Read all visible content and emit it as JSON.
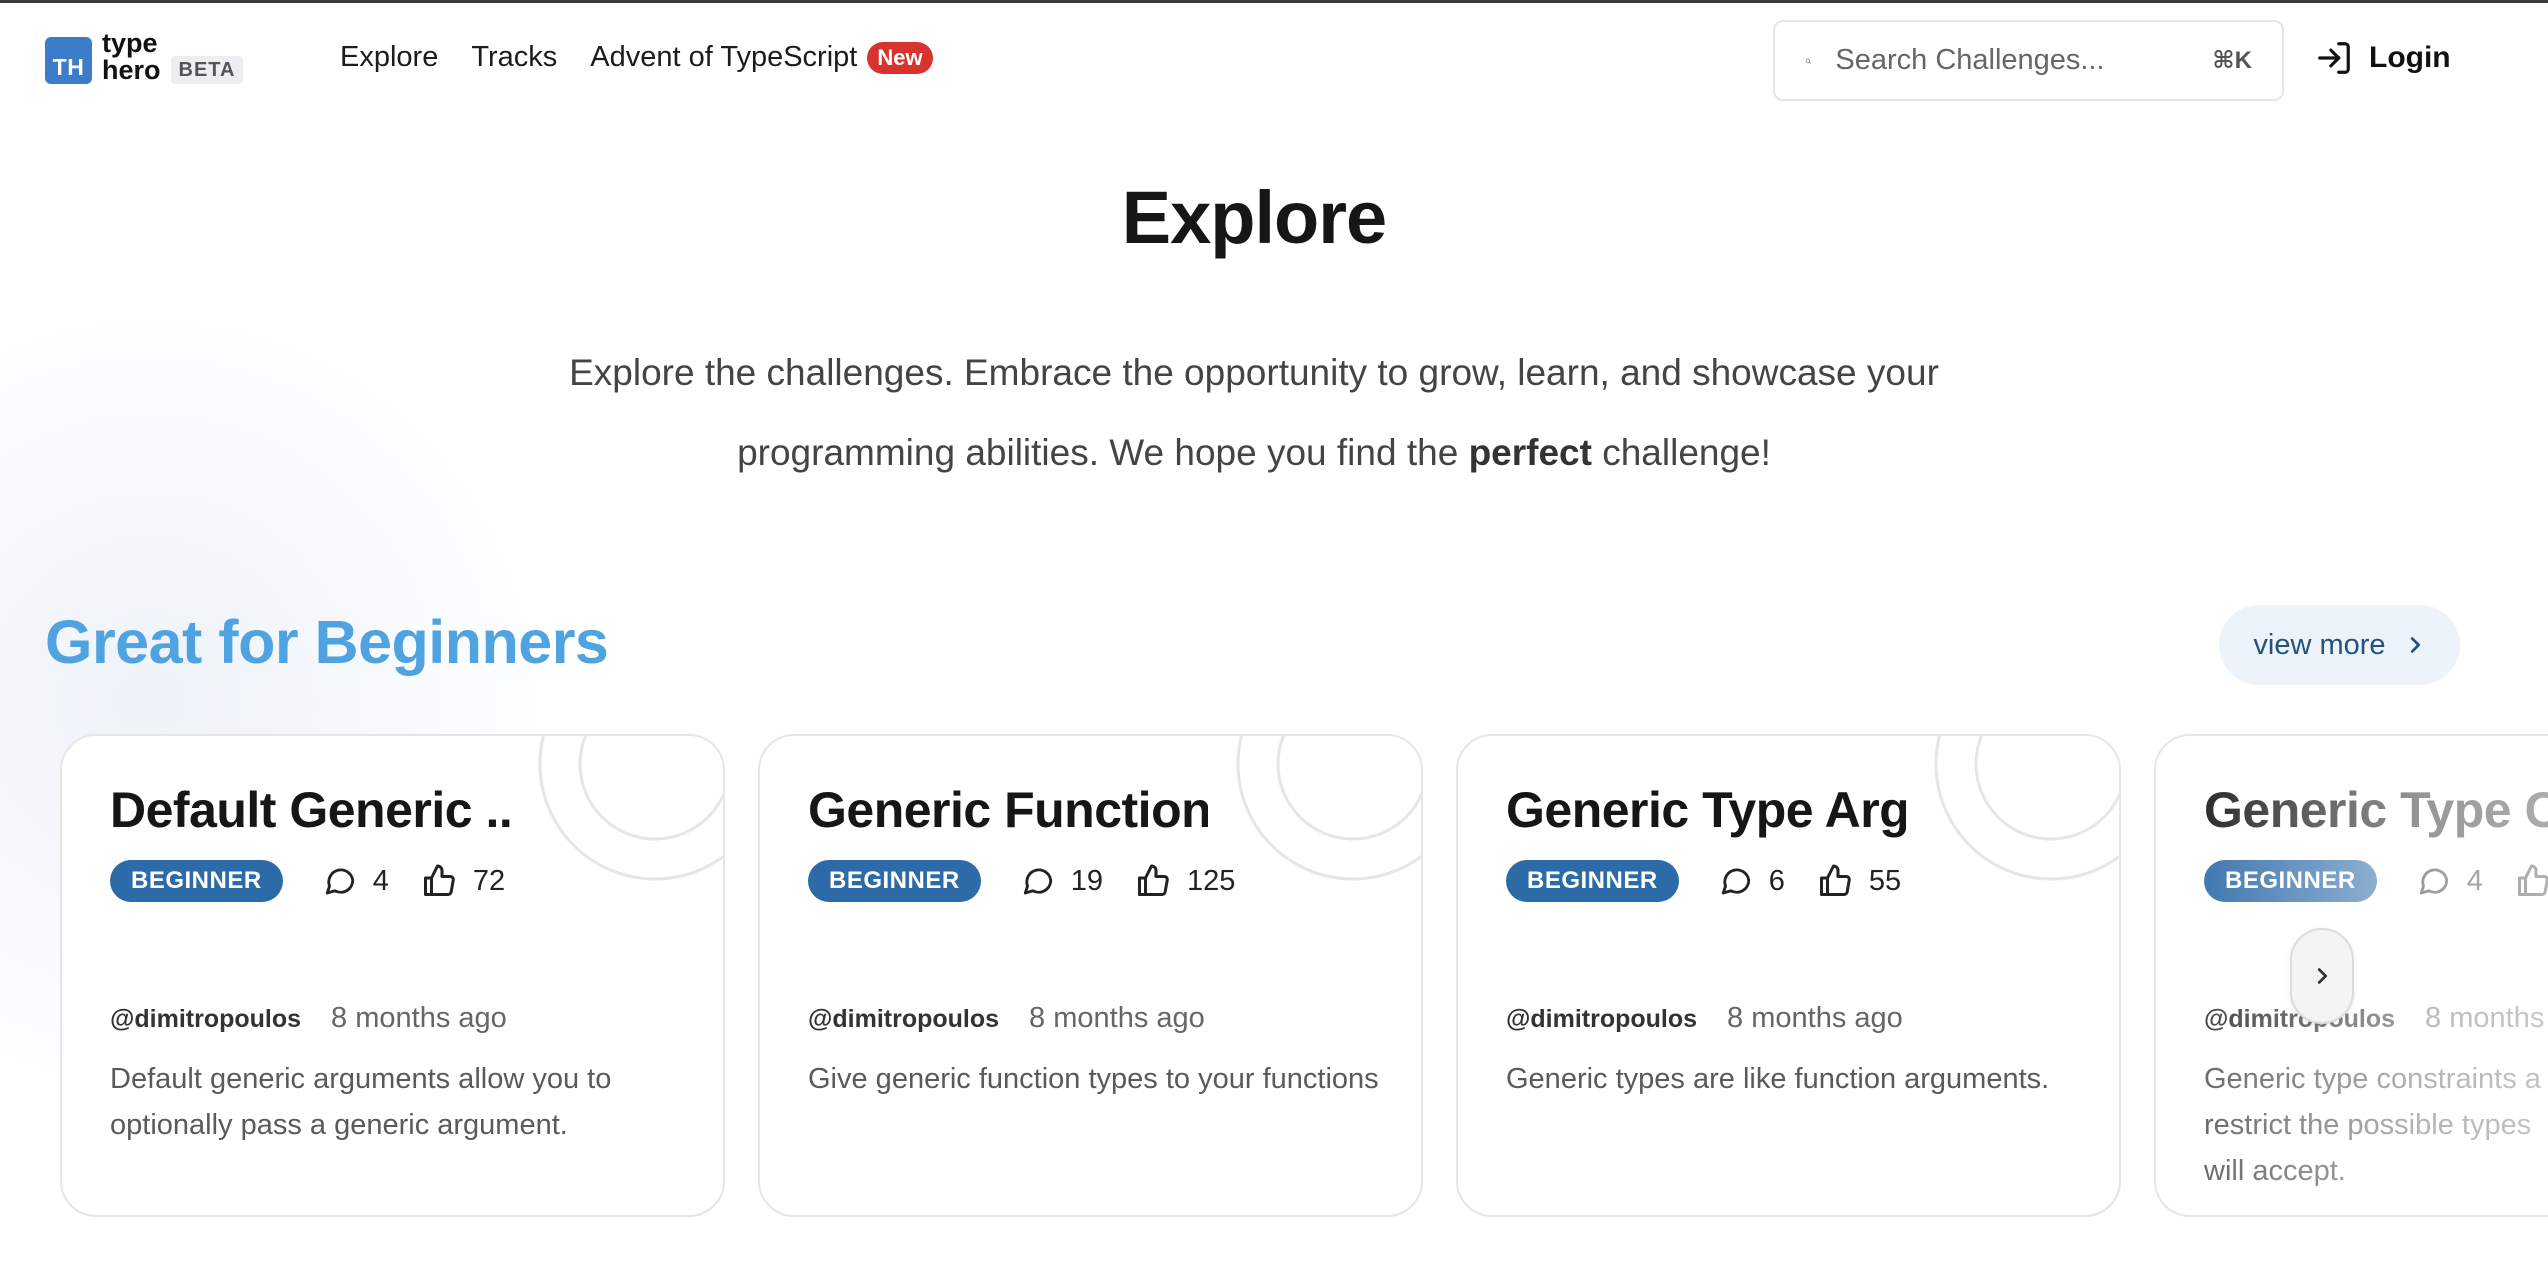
{
  "header": {
    "logo_mark": "TH",
    "logo_line1": "type",
    "logo_line2": "hero",
    "beta_label": "BETA",
    "nav": {
      "explore": "Explore",
      "tracks": "Tracks",
      "advent": "Advent of TypeScript",
      "advent_badge": "New"
    },
    "search_placeholder": "Search Challenges...",
    "search_shortcut": "⌘K",
    "login_label": "Login"
  },
  "hero": {
    "title": "Explore",
    "subtitle_before": "Explore the challenges. Embrace the opportunity to grow, learn, and showcase your programming abilities. We hope you find the ",
    "subtitle_bold": "perfect",
    "subtitle_after": " challenge!"
  },
  "section": {
    "title": "Great for Beginners",
    "view_more": "view more"
  },
  "cards": [
    {
      "title": "Default Generic ...",
      "level": "BEGINNER",
      "comments": "4",
      "likes": "72",
      "author": "@dimitropoulos",
      "time": "8 months ago",
      "description": "Default generic arguments allow you to optionally pass a generic argument."
    },
    {
      "title": "Generic Function...",
      "level": "BEGINNER",
      "comments": "19",
      "likes": "125",
      "author": "@dimitropoulos",
      "time": "8 months ago",
      "description": "Give generic function types to your functions"
    },
    {
      "title": "Generic Type Arg...",
      "level": "BEGINNER",
      "comments": "6",
      "likes": "55",
      "author": "@dimitropoulos",
      "time": "8 months ago",
      "description": "Generic types are like function arguments."
    },
    {
      "title": "Generic Type Co",
      "level": "BEGINNER",
      "comments": "4",
      "likes": "",
      "author": "@dimitropoulos",
      "time": "8 months",
      "description": "Generic type constraints a restrict the possible types will accept."
    }
  ],
  "colors": {
    "brand": "#3b7dc8",
    "section_title": "#4fa3e0",
    "level_badge": "#2c6aa8",
    "new_badge": "#d8342f",
    "view_more_bg": "#ecf3fa"
  },
  "icons": {
    "search": "search-icon",
    "login": "login-icon",
    "comments": "comment-icon",
    "likes": "thumbs-up-icon",
    "chevron": "chevron-right-icon"
  }
}
